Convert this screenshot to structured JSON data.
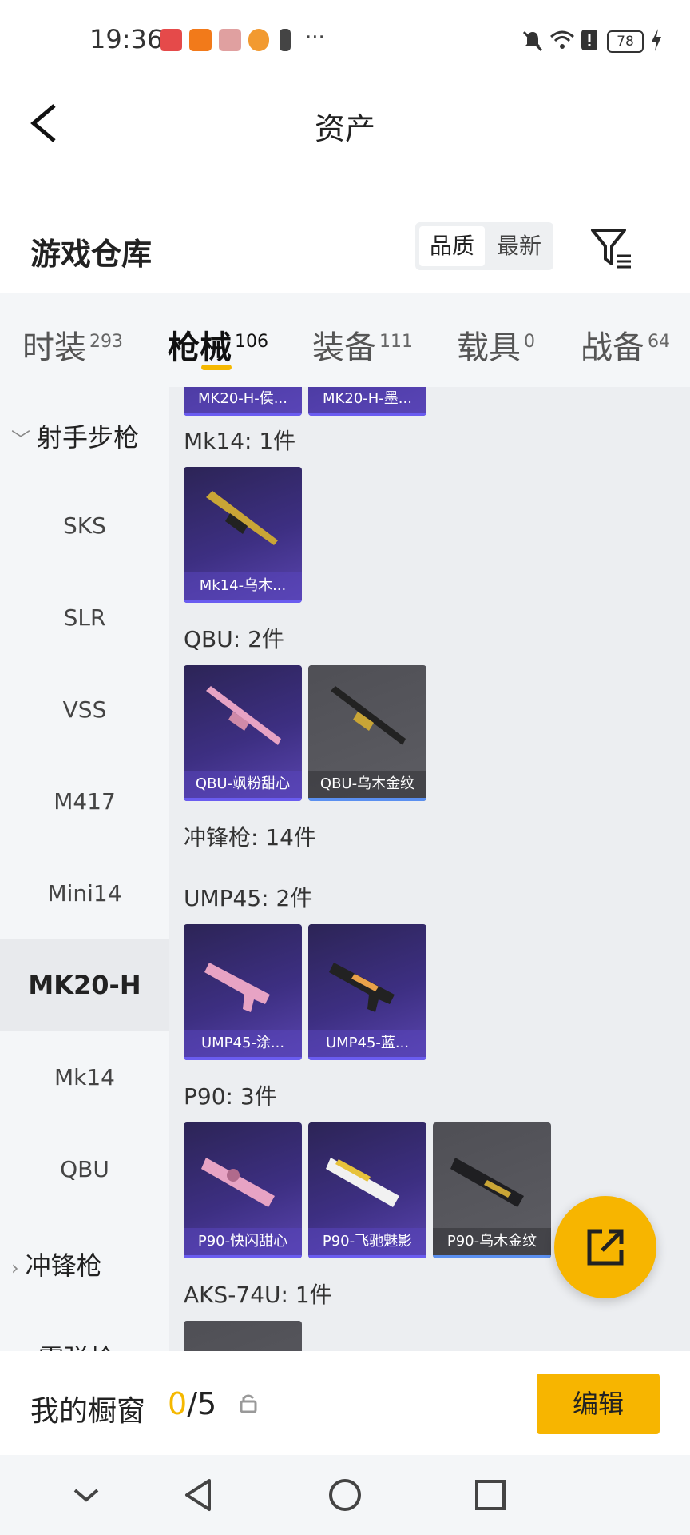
{
  "status_bar": {
    "time": "19:36",
    "battery": "78"
  },
  "header": {
    "title": "资产"
  },
  "section": {
    "title": "游戏仓库",
    "sort_quality": "品质",
    "sort_newest": "最新"
  },
  "tabs": [
    {
      "label": "时装",
      "count": "293"
    },
    {
      "label": "枪械",
      "count": "106"
    },
    {
      "label": "装备",
      "count": "111"
    },
    {
      "label": "载具",
      "count": "0"
    },
    {
      "label": "战备",
      "count": "64"
    }
  ],
  "sidebar": {
    "group_marksman": "射手步枪",
    "items": [
      "SKS",
      "SLR",
      "VSS",
      "M417",
      "Mini14",
      "MK20-H",
      "Mk14",
      "QBU"
    ],
    "group_smg": "冲锋枪",
    "group_partial": "霰弹枪"
  },
  "main": {
    "top_cards": [
      "MK20-H-侯...",
      "MK20-H-墨..."
    ],
    "groups": [
      {
        "label": "Mk14: 1件",
        "cards": [
          "Mk14-乌木..."
        ]
      },
      {
        "label": "QBU: 2件",
        "cards": [
          "QBU-飒粉甜心",
          "QBU-乌木金纹"
        ]
      },
      {
        "label": "冲锋枪: 14件",
        "cards": []
      },
      {
        "label": "UMP45: 2件",
        "cards": [
          "UMP45-涂...",
          "UMP45-蓝..."
        ]
      },
      {
        "label": "P90: 3件",
        "cards": [
          "P90-快闪甜心",
          "P90-飞驰魅影",
          "P90-乌木金纹"
        ]
      },
      {
        "label": "AKS-74U: 1件",
        "cards": []
      }
    ]
  },
  "bottom": {
    "showcase_label": "我的橱窗",
    "current": "0",
    "total": "/5",
    "edit_label": "编辑"
  },
  "colors": {
    "accent": "#f7b500",
    "card_purple": "#3d2f82",
    "card_gray": "#58585e"
  }
}
